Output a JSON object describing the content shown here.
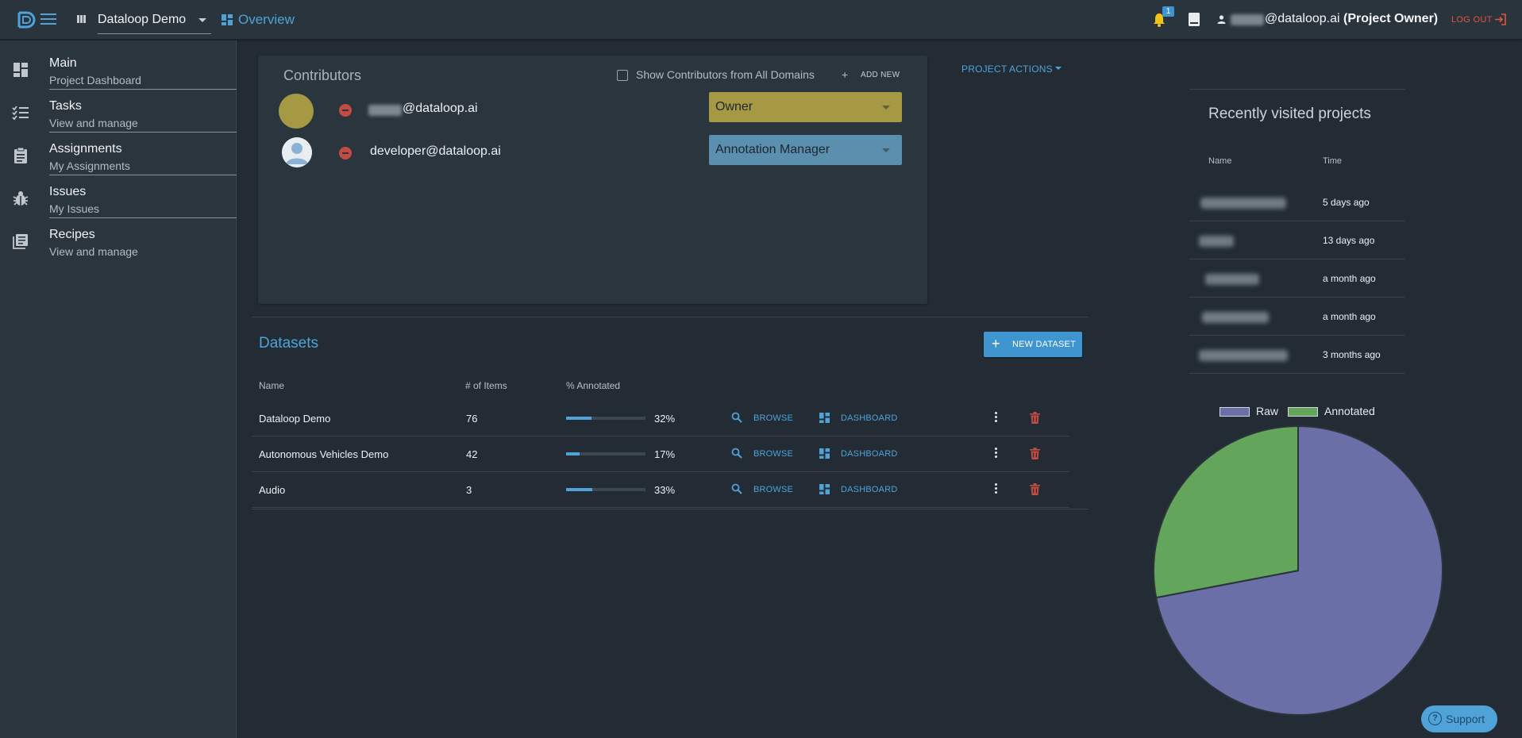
{
  "header": {
    "project_name": "Dataloop Demo",
    "overview_label": "Overview",
    "notification_count": "1",
    "user_email": "@dataloop.ai",
    "user_role": "(Project Owner)",
    "logout_label": "LOG OUT"
  },
  "sidebar": {
    "items": [
      {
        "title": "Main",
        "subtitle": "Project Dashboard",
        "icon": "dashboard-icon"
      },
      {
        "title": "Tasks",
        "subtitle": "View and manage",
        "icon": "checklist-icon"
      },
      {
        "title": "Assignments",
        "subtitle": "My Assignments",
        "icon": "clipboard-icon"
      },
      {
        "title": "Issues",
        "subtitle": "My Issues",
        "icon": "bug-icon"
      },
      {
        "title": "Recipes",
        "subtitle": "View and manage",
        "icon": "recipe-book-icon"
      }
    ]
  },
  "contributors": {
    "title": "Contributors",
    "show_all_label": "Show Contributors from All Domains",
    "show_all_checked": false,
    "add_new_label": "ADD NEW",
    "rows": [
      {
        "email": "@dataloop.ai",
        "role": "Owner",
        "role_color": "#a59a43"
      },
      {
        "email": "developer@dataloop.ai",
        "role": "Annotation Manager",
        "role_color": "#5b8fae"
      }
    ]
  },
  "project_actions_label": "PROJECT ACTIONS",
  "datasets": {
    "title": "Datasets",
    "new_dataset_label": "NEW DATASET",
    "columns": [
      "Name",
      "# of Items",
      "% Annotated"
    ],
    "browse_label": "BROWSE",
    "dashboard_label": "DASHBOARD",
    "rows": [
      {
        "name": "Dataloop Demo",
        "items": "76",
        "percent_label": "32%",
        "percent": 0.32
      },
      {
        "name": "Autonomous Vehicles Demo",
        "items": "42",
        "percent_label": "17%",
        "percent": 0.17
      },
      {
        "name": "Audio",
        "items": "3",
        "percent_label": "33%",
        "percent": 0.33
      }
    ]
  },
  "recent": {
    "title": "Recently visited projects",
    "columns": [
      "Name",
      "Time"
    ],
    "rows": [
      {
        "time": "5 days ago"
      },
      {
        "time": "13 days ago"
      },
      {
        "time": "a month ago"
      },
      {
        "time": "a month ago"
      },
      {
        "time": "3 months ago"
      }
    ]
  },
  "chart_data": {
    "type": "pie",
    "series": [
      {
        "name": "Raw",
        "value": 0.72,
        "color": "#6b6fa8"
      },
      {
        "name": "Annotated",
        "value": 0.28,
        "color": "#63a55b"
      }
    ],
    "legend": "top"
  },
  "support_label": "Support",
  "colors": {
    "accent": "#4fa3d9",
    "danger": "#c44b44",
    "logout": "#e2553f"
  }
}
